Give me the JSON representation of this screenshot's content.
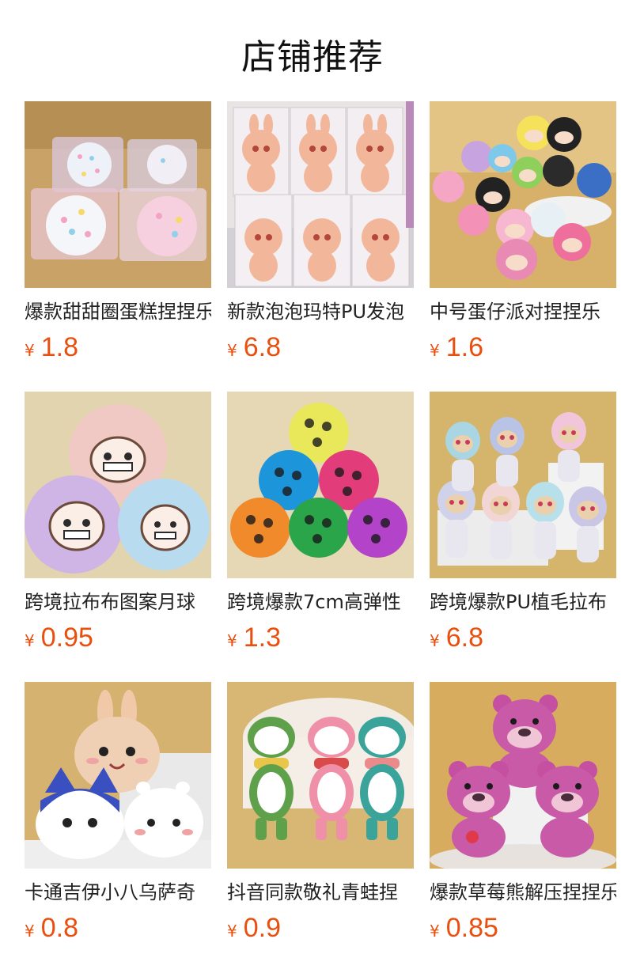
{
  "page": {
    "title": "店铺推荐"
  },
  "colors": {
    "price": "#e9500f",
    "title": "#222222"
  },
  "products": [
    {
      "title": "爆款甜甜圈蛋糕捏捏乐",
      "currency": "¥",
      "price": "1.8",
      "image_icon": "squishy-donut-image"
    },
    {
      "title": "新款泡泡玛特PU发泡",
      "currency": "¥",
      "price": "6.8",
      "image_icon": "bunny-figure-boxes-image"
    },
    {
      "title": "中号蛋仔派对捏捏乐",
      "currency": "¥",
      "price": "1.6",
      "image_icon": "egg-party-figures-image"
    },
    {
      "title": "跨境拉布布图案月球",
      "currency": "¥",
      "price": "0.95",
      "image_icon": "printed-moon-balls-image"
    },
    {
      "title": "跨境爆款7cm高弹性",
      "currency": "¥",
      "price": "1.3",
      "image_icon": "colorful-moon-balls-image"
    },
    {
      "title": "跨境爆款PU植毛拉布",
      "currency": "¥",
      "price": "6.8",
      "image_icon": "flocked-bunny-figures-image"
    },
    {
      "title": "卡通吉伊小八乌萨奇",
      "currency": "¥",
      "price": "0.8",
      "image_icon": "chiikawa-squishies-image"
    },
    {
      "title": "抖音同款敬礼青蛙捏",
      "currency": "¥",
      "price": "0.9",
      "image_icon": "saluting-frog-figures-image"
    },
    {
      "title": "爆款草莓熊解压捏捏乐",
      "currency": "¥",
      "price": "0.85",
      "image_icon": "strawberry-bear-image"
    }
  ]
}
